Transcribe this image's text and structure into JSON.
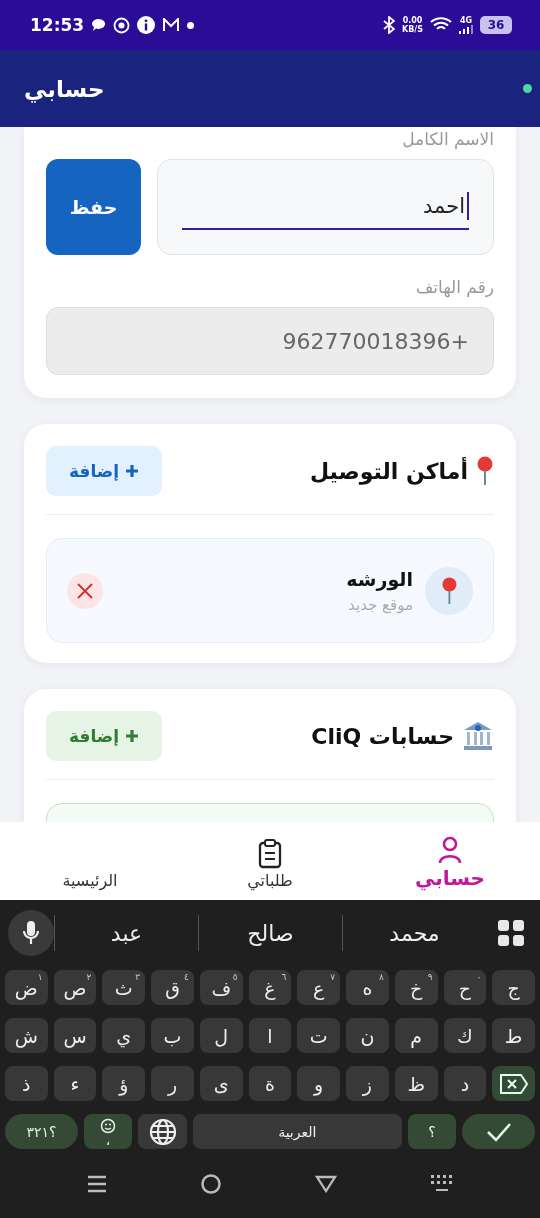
{
  "status_bar": {
    "time": "12:53",
    "net_speed": "0.00",
    "net_unit": "KB/S",
    "network": "4G",
    "battery": "36"
  },
  "app_bar": {
    "title": "حسابي",
    "online": true
  },
  "profile": {
    "name_label": "الاسم الكامل",
    "name_value": "احمد",
    "save": "حفظ",
    "phone_label": "رقم الهاتف",
    "phone_value": "+962770018396",
    "phone_disabled": true
  },
  "addresses": {
    "title": "أماكن التوصيل",
    "add": "إضافة",
    "items": [
      {
        "name": "الورشه",
        "subtitle": "موقع جديد"
      }
    ]
  },
  "cliq": {
    "title": "حسابات CliQ",
    "add": "إضافة"
  },
  "bottom_nav": [
    {
      "label": "حسابي",
      "kind": "person",
      "selected": true
    },
    {
      "label": "طلباتي",
      "kind": "clipboard",
      "selected": false
    },
    {
      "label": "الرئيسية",
      "kind": "text",
      "selected": false
    }
  ],
  "keyboard": {
    "suggestions": [
      "محمد",
      "صالح",
      "عبد"
    ],
    "rows": [
      [
        {
          "kind": "char",
          "label": "ج"
        },
        {
          "kind": "char",
          "label": "ح",
          "hint": "٠"
        },
        {
          "kind": "char",
          "label": "خ",
          "hint": "٩"
        },
        {
          "kind": "char",
          "label": "ه",
          "hint": "٨"
        },
        {
          "kind": "char",
          "label": "ع",
          "hint": "٧"
        },
        {
          "kind": "char",
          "label": "غ",
          "hint": "٦"
        },
        {
          "kind": "char",
          "label": "ف",
          "hint": "٥"
        },
        {
          "kind": "char",
          "label": "ق",
          "hint": "٤"
        },
        {
          "kind": "char",
          "label": "ث",
          "hint": "٣"
        },
        {
          "kind": "char",
          "label": "ص",
          "hint": "٢"
        },
        {
          "kind": "char",
          "label": "ض",
          "hint": "١"
        }
      ],
      [
        {
          "kind": "char",
          "label": "ط"
        },
        {
          "kind": "char",
          "label": "ك"
        },
        {
          "kind": "char",
          "label": "م"
        },
        {
          "kind": "char",
          "label": "ن"
        },
        {
          "kind": "char",
          "label": "ت"
        },
        {
          "kind": "char",
          "label": "ا"
        },
        {
          "kind": "char",
          "label": "ل"
        },
        {
          "kind": "char",
          "label": "ب"
        },
        {
          "kind": "char",
          "label": "ي"
        },
        {
          "kind": "char",
          "label": "س"
        },
        {
          "kind": "char",
          "label": "ش"
        }
      ],
      [
        {
          "kind": "backspace"
        },
        {
          "kind": "char",
          "label": "د"
        },
        {
          "kind": "char",
          "label": "ظ"
        },
        {
          "kind": "char",
          "label": "ز"
        },
        {
          "kind": "char",
          "label": "و"
        },
        {
          "kind": "char",
          "label": "ة"
        },
        {
          "kind": "char",
          "label": "ى"
        },
        {
          "kind": "char",
          "label": "ر"
        },
        {
          "kind": "char",
          "label": "ؤ"
        },
        {
          "kind": "char",
          "label": "ء"
        },
        {
          "kind": "char",
          "label": "ذ"
        }
      ],
      [
        {
          "kind": "enter"
        },
        {
          "kind": "punct",
          "label": "؟"
        },
        {
          "kind": "space",
          "label": "العربية"
        },
        {
          "kind": "globe"
        },
        {
          "kind": "emoji",
          "label": "،"
        },
        {
          "kind": "symbols",
          "label": "؟٣٢١"
        }
      ]
    ]
  }
}
